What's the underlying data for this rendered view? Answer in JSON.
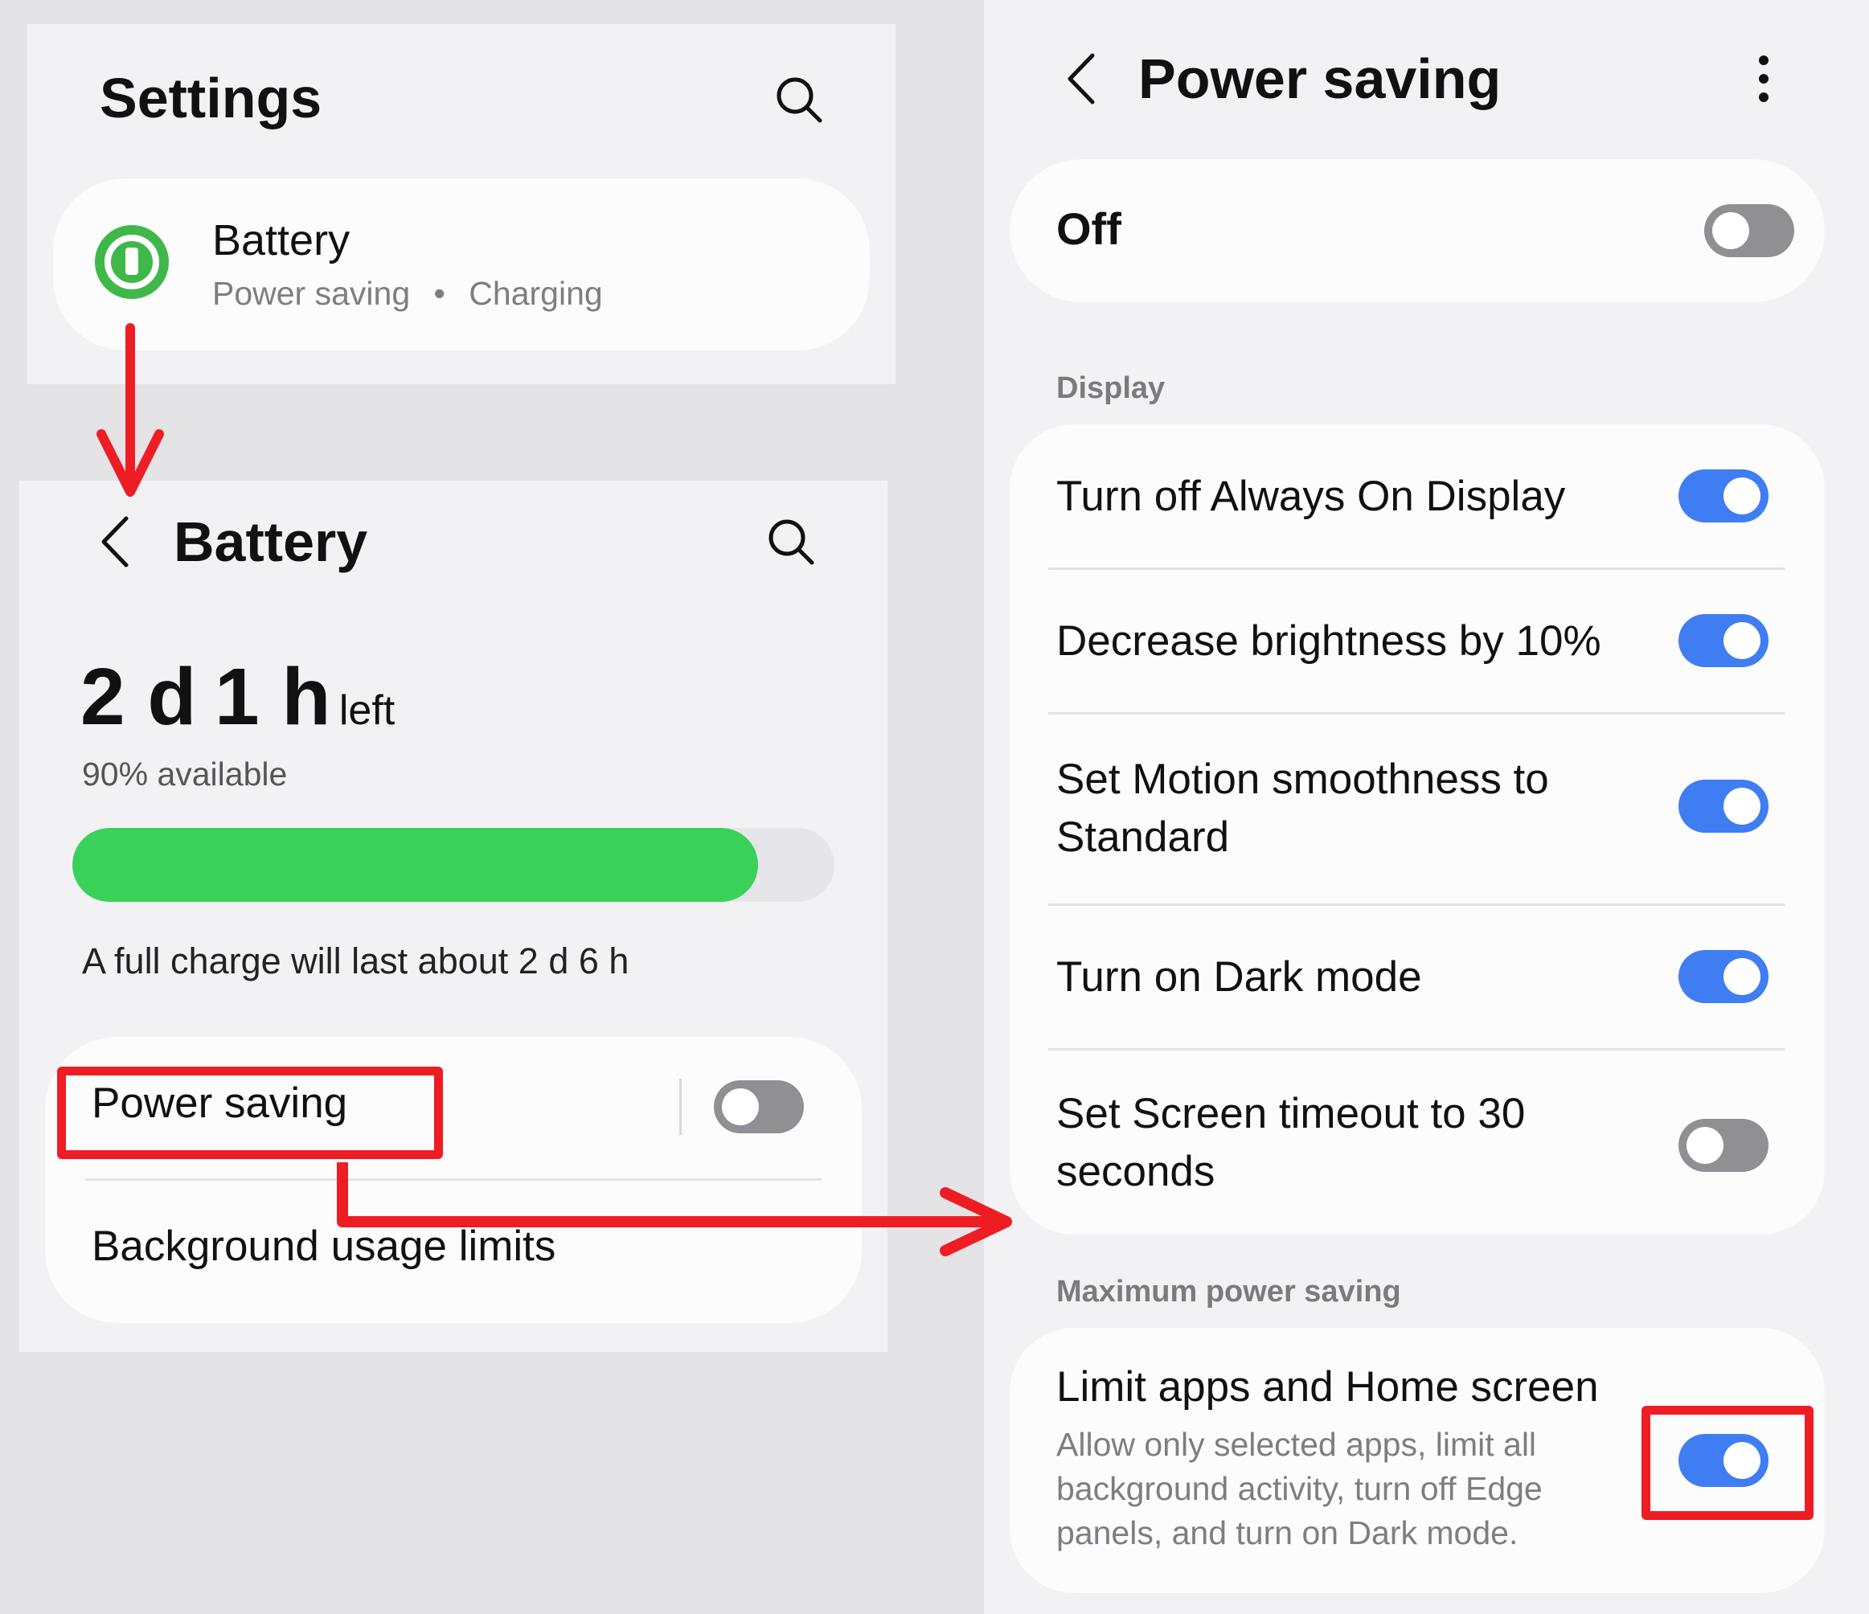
{
  "settings_panel": {
    "title": "Settings",
    "battery_item": {
      "title": "Battery",
      "subtitle_left": "Power saving",
      "subtitle_sep": "•",
      "subtitle_right": "Charging"
    }
  },
  "battery_panel": {
    "title": "Battery",
    "time_days": "2 d",
    "time_hours": "1 h",
    "time_suffix": "left",
    "available": "90% available",
    "battery_level_percent": 90,
    "full_charge": "A full charge will last about 2 d 6 h",
    "power_saving_label": "Power saving",
    "power_saving_enabled": false,
    "background_limits_label": "Background usage limits"
  },
  "power_saving_panel": {
    "title": "Power saving",
    "master": {
      "label": "Off",
      "enabled": false
    },
    "display_section": "Display",
    "display_options": [
      {
        "label": "Turn off Always On Display",
        "enabled": true
      },
      {
        "label": "Decrease brightness by 10%",
        "enabled": true
      },
      {
        "label_line1": "Set Motion smoothness to",
        "label_line2": "Standard",
        "enabled": true
      },
      {
        "label": "Turn on Dark mode",
        "enabled": true
      },
      {
        "label_line1": "Set Screen timeout to 30",
        "label_line2": "seconds",
        "enabled": false
      }
    ],
    "max_section": "Maximum power saving",
    "limit_apps": {
      "title": "Limit apps and Home screen",
      "desc_line1": "Allow only selected apps, limit all",
      "desc_line2": "background activity, turn off Edge",
      "desc_line3": "panels, and turn on Dark mode.",
      "enabled": true
    }
  },
  "colors": {
    "accent_blue": "#3f7df3",
    "battery_green": "#3ad15a",
    "annotation_red": "#ee1d24",
    "toggle_off": "#909094"
  },
  "icons": [
    "search-icon",
    "back-icon",
    "more-options-icon",
    "battery-icon"
  ]
}
